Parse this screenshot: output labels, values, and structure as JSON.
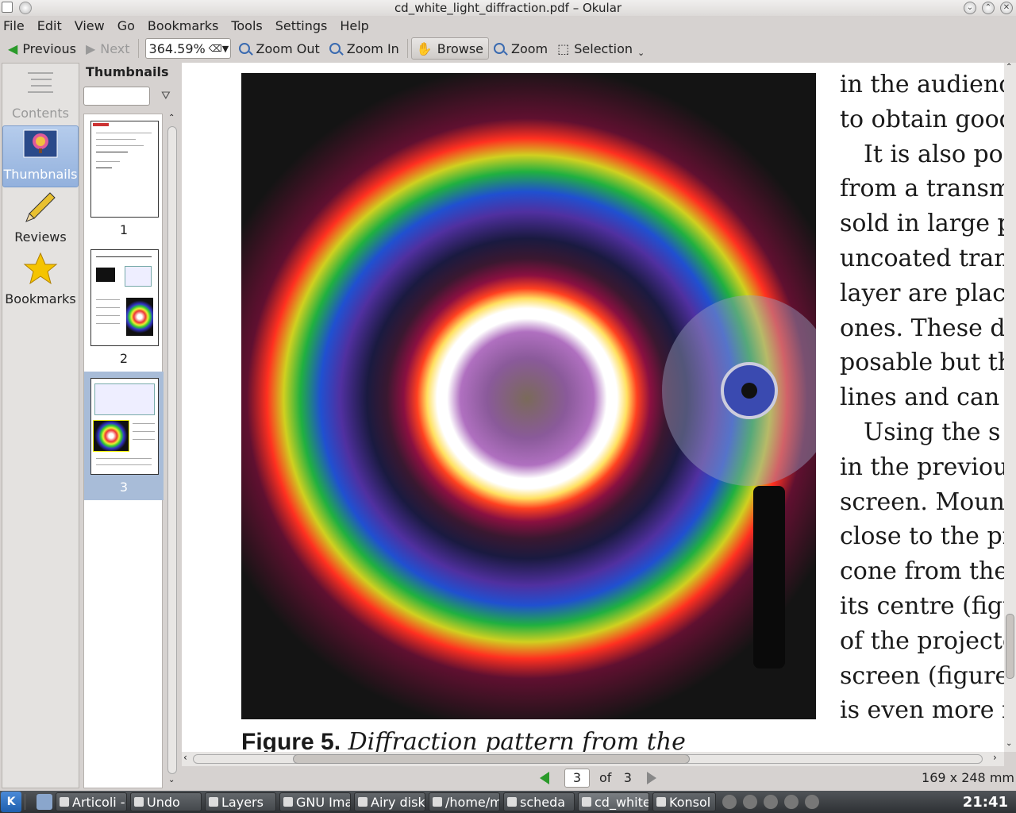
{
  "window": {
    "title": "cd_white_light_diffraction.pdf – Okular"
  },
  "menu": [
    "File",
    "Edit",
    "View",
    "Go",
    "Bookmarks",
    "Tools",
    "Settings",
    "Help"
  ],
  "toolbar": {
    "previous": "Previous",
    "next": "Next",
    "zoom_value": "364.59%",
    "zoom_out": "Zoom Out",
    "zoom_in": "Zoom In",
    "browse": "Browse",
    "zoom": "Zoom",
    "selection": "Selection"
  },
  "sidebar": {
    "items": [
      {
        "label": "Contents",
        "icon": "contents-icon",
        "state": "disabled"
      },
      {
        "label": "Thumbnails",
        "icon": "thumbnails-icon",
        "state": "selected"
      },
      {
        "label": "Reviews",
        "icon": "pencil-icon",
        "state": "normal"
      },
      {
        "label": "Bookmarks",
        "icon": "star-icon",
        "state": "normal"
      }
    ]
  },
  "thumbnails": {
    "title": "Thumbnails",
    "pages": [
      "1",
      "2",
      "3"
    ],
    "selected_page": "3"
  },
  "document": {
    "text_lines": [
      "in the audienc",
      "to obtain good",
      "It is also po",
      "from a transm",
      "sold in large p",
      "uncoated tran",
      "layer are place",
      "ones. These di",
      "posable but th",
      "lines and can b",
      "Using the s",
      "in the previou",
      "screen. Moun",
      "close to the pr",
      "cone from the",
      "its centre (figu",
      "of the projecto",
      "screen (figure",
      "is even more in"
    ],
    "caption_bold": "Figure 5.",
    "caption_italic": "Diffraction pattern from the"
  },
  "pagenav": {
    "current": "3",
    "of": "of",
    "total": "3",
    "page_size": "169 x 248 mm"
  },
  "taskbar": {
    "tasks": [
      "Articoli -",
      "Undo",
      "Layers",
      "GNU Ima",
      "Airy disk",
      "/home/m",
      "scheda",
      "cd_white",
      "Konsol"
    ],
    "desktop_count": "2",
    "clock": "21:41"
  },
  "colors": {
    "selection_blue": "#93b1dd",
    "prev_arrow": "#2a9a2a",
    "taskbar": "#3a3d40"
  }
}
